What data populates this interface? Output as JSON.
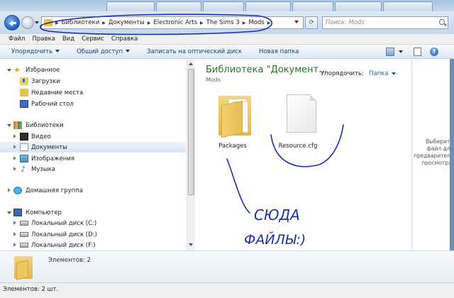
{
  "tabs": [
    {
      "label": "",
      "color": "#6b8cb0"
    },
    {
      "label": "",
      "color": "#6b8cb0"
    },
    {
      "label": "",
      "color": "#6b8cb0"
    },
    {
      "label": "",
      "color": "#6b8cb0"
    },
    {
      "label": "",
      "color": "#6b8cb0"
    },
    {
      "label": "",
      "color": "#6b8cb0"
    },
    {
      "label": "",
      "color": "#6b8cb0"
    }
  ],
  "address": {
    "crumbs": [
      "Библиотеки",
      "Документы",
      "Electronic Arts",
      "The Sims 3",
      "Mods"
    ],
    "search_placeholder": "Поиск: Mods"
  },
  "menu": [
    "Файл",
    "Правка",
    "Вид",
    "Сервис",
    "Справка"
  ],
  "commands": {
    "organize": "Упорядочить",
    "share": "Общий доступ",
    "burn": "Записать на оптический диск",
    "new_folder": "Новая папка"
  },
  "nav": {
    "favorites": "Избранное",
    "downloads": "Загрузки",
    "recent": "Недавние места",
    "desktop": "Рабочий стол",
    "libraries": "Библиотеки",
    "video": "Видео",
    "documents": "Документы",
    "images": "Изображения",
    "music": "Музыка",
    "homegroup": "Домашняя группа",
    "computer": "Компьютер",
    "disk_c": "Локальный диск (C:)",
    "disk_d": "Локальный диск (D:)",
    "disk_f": "Локальный диск (F:)"
  },
  "content": {
    "title": "Библиотека \"Документ...",
    "subtitle": "Mods",
    "arrange_label": "Упорядочить:",
    "arrange_value": "Папка",
    "items": [
      {
        "name": "Packages",
        "kind": "folder-icon"
      },
      {
        "name": "Resource.cfg",
        "kind": "file-icon"
      }
    ]
  },
  "preview_text": "Выберите файл для предварительного просмотра.",
  "details": {
    "count_text": "Элементов: 2"
  },
  "status": {
    "text": "Элементов: 2 шт."
  },
  "annotation": {
    "line1": "СЮДА",
    "line2": "ФАЙЛЫ:)"
  },
  "colors": {
    "library_title": "#1f7a1f",
    "ink": "#1a2fb0",
    "selected_row": "#dbe7f5"
  }
}
